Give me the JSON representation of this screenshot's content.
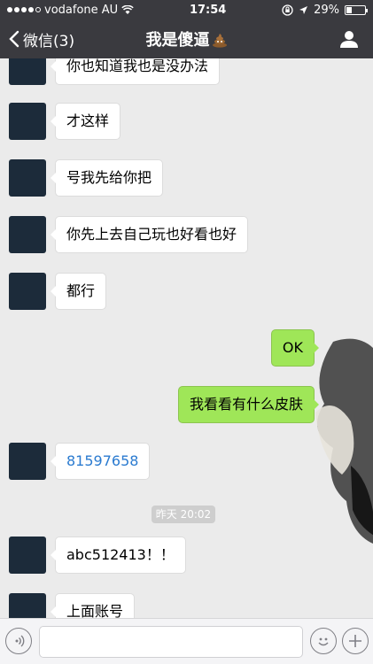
{
  "status": {
    "carrier": "vodafone AU",
    "time": "17:54",
    "battery": "29%",
    "battery_level": 0.29
  },
  "nav": {
    "back_label": "微信(3)",
    "title": "我是傻逼"
  },
  "messages": [
    {
      "from": "them",
      "text": "你也知道我也是没办法"
    },
    {
      "from": "them",
      "text": "才这样"
    },
    {
      "from": "them",
      "text": "号我先给你把"
    },
    {
      "from": "them",
      "text": "你先上去自己玩也好看也好"
    },
    {
      "from": "them",
      "text": "都行"
    },
    {
      "from": "me",
      "text": "OK"
    },
    {
      "from": "me",
      "text": "我看看有什么皮肤"
    },
    {
      "from": "them",
      "text": "81597658"
    },
    {
      "from": "them",
      "text": "abc512413！！"
    },
    {
      "from": "them",
      "text": "上面账号"
    }
  ],
  "timestamp": "昨天 20:02",
  "input": {
    "value": "",
    "placeholder": ""
  },
  "icons": {
    "back": "chevron-left-icon",
    "profile": "person-icon",
    "voice": "voice-icon",
    "emoji": "smiley-icon",
    "more": "plus-icon"
  }
}
